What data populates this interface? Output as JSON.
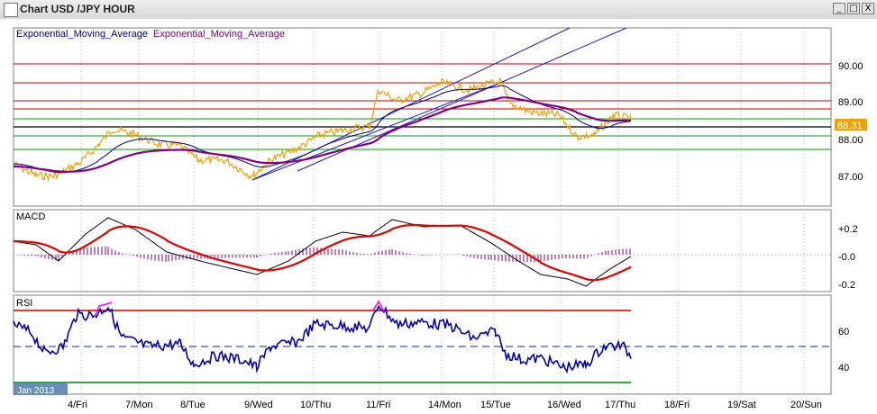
{
  "window": {
    "title": "Chart USD /JPY HOUR",
    "minimize_glyph": "_",
    "restore_glyph": "□",
    "close_glyph": "X"
  },
  "price_panel": {
    "indicator_label_1": "Exponential_Moving_Average",
    "indicator_label_2": "Exponential_Moving_Average",
    "current_price": "88.31",
    "axis_ticks": [
      "90.00",
      "89.00",
      "88.00",
      "87.00"
    ]
  },
  "macd_panel": {
    "label": "MACD",
    "axis_ticks": [
      "+0.2",
      "-0.0",
      "-0.2"
    ]
  },
  "rsi_panel": {
    "label": "RSI",
    "axis_ticks": [
      "60",
      "40"
    ]
  },
  "x_axis": {
    "start_label": "Jan 2013",
    "day_labels": [
      "4/Fri",
      "7/Mon",
      "8/Tue",
      "9/Wed",
      "10/Thu",
      "11/Fri",
      "14/Mon",
      "15/Tue",
      "16/Wed",
      "17/Thu",
      "18/Fri",
      "19/Sat",
      "20/Sun"
    ]
  },
  "colors": {
    "price": "#f0a000",
    "ema_fast": "#000080",
    "ema_slow": "#800080",
    "resistance": "#c00000",
    "support": "#00a000",
    "channel": "#0000c0",
    "macd_signal": "#e00000",
    "macd_line": "#000000",
    "macd_hist": "#800080",
    "rsi": "#0000b0",
    "rsi_extreme": "#ff00ff",
    "price_badge": "#f0a000"
  }
}
